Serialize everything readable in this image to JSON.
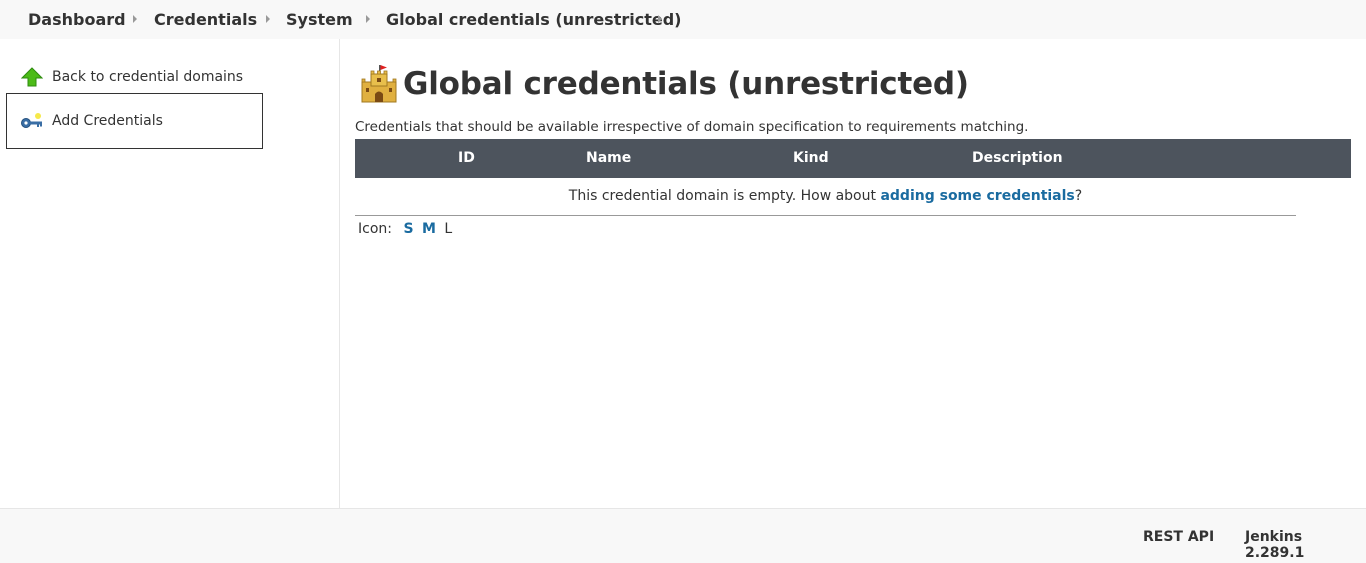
{
  "breadcrumbs": [
    {
      "label": "Dashboard"
    },
    {
      "label": "Credentials"
    },
    {
      "label": "System"
    },
    {
      "label": "Global credentials (unrestricted)"
    }
  ],
  "sidebar": {
    "items": [
      {
        "label": "Back to credential domains",
        "icon": "up-arrow-icon"
      },
      {
        "label": "Add Credentials",
        "icon": "key-icon"
      }
    ]
  },
  "main": {
    "title": "Global credentials (unrestricted)",
    "title_icon": "castle-icon",
    "description": "Credentials that should be available irrespective of domain specification to requirements matching.",
    "table": {
      "columns": [
        "ID",
        "Name",
        "Kind",
        "Description"
      ],
      "empty_text_before": "This credential domain is empty. How about ",
      "empty_link": "adding some credentials",
      "empty_text_after": "?"
    },
    "icon_size": {
      "label": "Icon:",
      "options": [
        "S",
        "M",
        "L"
      ],
      "current": "L"
    }
  },
  "footer": {
    "rest_api": "REST API",
    "version": "Jenkins 2.289.1"
  },
  "colors": {
    "table_header_bg": "#4d545d",
    "link": "#1a6ba0",
    "bar_bg": "#f8f8f8"
  }
}
